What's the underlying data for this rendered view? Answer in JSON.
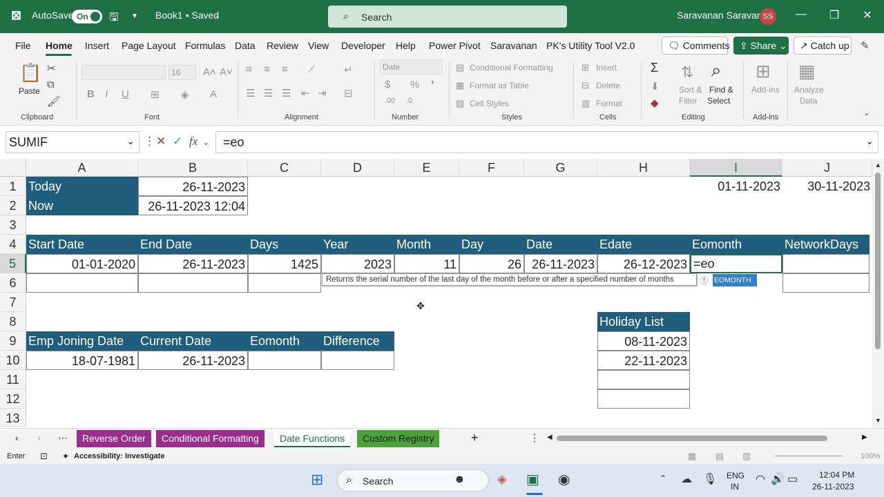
{
  "titlebar": {
    "autosave_label": "AutoSave",
    "autosave_state": "On",
    "doc_title": "Book1 • Saved",
    "search_placeholder": "Search",
    "user_name": "Saravanan Saravanan",
    "user_initials": "SS"
  },
  "menu": [
    "File",
    "Home",
    "Insert",
    "Page Layout",
    "Formulas",
    "Data",
    "Review",
    "View",
    "Developer",
    "Help",
    "Power Pivot",
    "Saravanan",
    "PK's Utility Tool V2.0"
  ],
  "menu_right": {
    "comments": "Comments",
    "share": "Share",
    "catchup": "Catch up"
  },
  "ribbon": {
    "clipboard": {
      "paste": "Paste",
      "label": "Clipboard"
    },
    "font": {
      "size": "16",
      "label": "Font"
    },
    "alignment": {
      "label": "Alignment"
    },
    "number": {
      "format": "Date",
      "label": "Number"
    },
    "styles": {
      "cond": "Conditional Formatting",
      "table": "Format as Table",
      "cell": "Cell Styles",
      "label": "Styles"
    },
    "cells": {
      "insert": "Insert",
      "delete": "Delete",
      "format": "Format",
      "label": "Cells"
    },
    "editing": {
      "sort1": "Sort &",
      "sort2": "Filter",
      "find1": "Find &",
      "find2": "Select",
      "label": "Editing"
    },
    "addins": {
      "addins": "Add-ins",
      "label": "Add-ins"
    },
    "analyze": {
      "l1": "Analyze",
      "l2": "Data"
    }
  },
  "formula_bar": {
    "name_box": "SUMIF",
    "formula": "=eo"
  },
  "columns": [
    "A",
    "B",
    "C",
    "D",
    "E",
    "F",
    "G",
    "H",
    "I",
    "J"
  ],
  "rows": [
    "1",
    "2",
    "3",
    "4",
    "5",
    "6",
    "7",
    "8",
    "9",
    "10",
    "11",
    "12",
    "13"
  ],
  "cells": {
    "a1": "Today",
    "b1": "26-11-2023",
    "i1": "01-11-2023",
    "j1": "30-11-2023",
    "a2": "Now",
    "b2": "26-11-2023 12:04",
    "a4": "Start Date",
    "b4": "End Date",
    "c4": "Days",
    "d4": "Year",
    "e4": "Month",
    "f4": "Day",
    "g4": "Date",
    "h4": "Edate",
    "i4": "Eomonth",
    "j4": "NetworkDays",
    "a5": "01-01-2020",
    "b5": "26-11-2023",
    "c5": "1425",
    "d5": "2023",
    "e5": "11",
    "f5": "26",
    "g5": "26-11-2023",
    "h5": "26-12-2023",
    "i5": "=eo",
    "h8": "Holiday List",
    "a9": "Emp Joning Date",
    "b9": "Current Date",
    "c9": "Eomonth",
    "d9": "Difference",
    "h9": "08-11-2023",
    "a10": "18-07-1981",
    "b10": "26-11-2023",
    "h10": "22-11-2023"
  },
  "autocomplete": {
    "tooltip": "Returns the serial number of the last day of the month before or after a specified number of months",
    "suggestion": "EOMONTH"
  },
  "sheets": [
    {
      "name": "Reverse Order",
      "color": "#9b2d8f"
    },
    {
      "name": "Conditional Formatting",
      "color": "#9b2d8f"
    },
    {
      "name": "Date Functions",
      "color": "#ffffff"
    },
    {
      "name": "Custom Registry",
      "color": "#4aa33a"
    }
  ],
  "status": {
    "mode": "Enter",
    "accessibility": "Accessibility: Investigate",
    "zoom": "100%"
  },
  "taskbar": {
    "search": "Search",
    "lang1": "ENG",
    "lang2": "IN",
    "time": "12:04 PM",
    "date": "26-11-2023"
  },
  "colors": {
    "excel_green": "#1e7145",
    "header_blue": "#1f5f7d"
  }
}
